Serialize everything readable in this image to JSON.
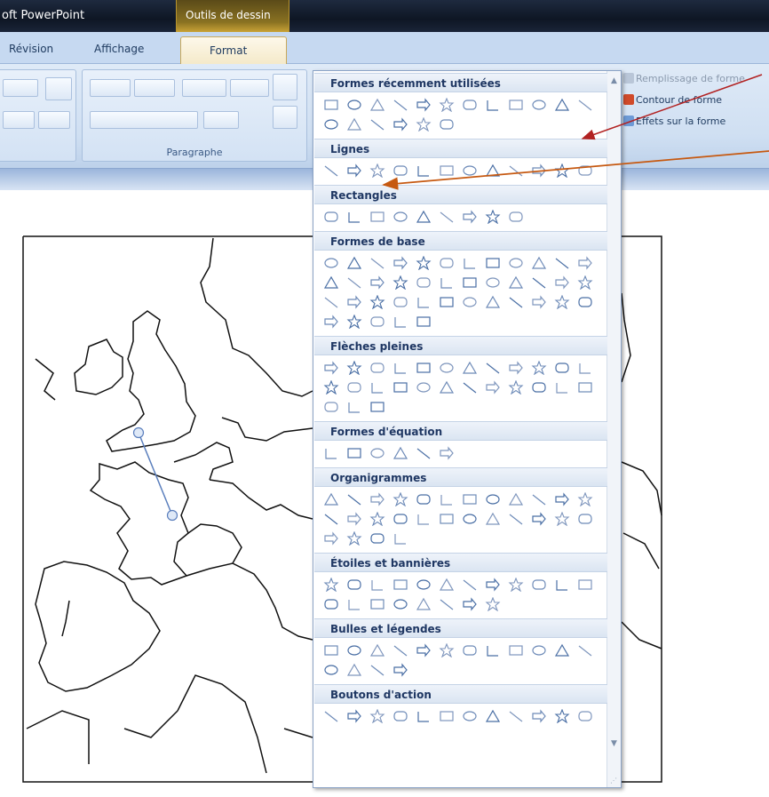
{
  "titlebar": {
    "app_title": "oft PowerPoint",
    "context_tab": "Outils de dessin"
  },
  "ribbon_tabs": {
    "revision": "Révision",
    "affichage": "Affichage",
    "format": "Format"
  },
  "ribbon": {
    "paragraph_group": "Paragraphe",
    "remplissage": "Remplissage de forme",
    "contour": "Contour de forme",
    "effets": "Effets sur la forme"
  },
  "gallery": {
    "sections": [
      {
        "title": "Formes récemment utilisées",
        "rows": [
          12,
          6
        ]
      },
      {
        "title": "Lignes",
        "rows": [
          12
        ]
      },
      {
        "title": "Rectangles",
        "rows": [
          9
        ]
      },
      {
        "title": "Formes de base",
        "rows": [
          12,
          12,
          12,
          5
        ]
      },
      {
        "title": "Flèches pleines",
        "rows": [
          12,
          12,
          3
        ]
      },
      {
        "title": "Formes d'équation",
        "rows": [
          6
        ]
      },
      {
        "title": "Organigrammes",
        "rows": [
          12,
          12,
          4
        ]
      },
      {
        "title": "Étoiles et bannières",
        "rows": [
          12,
          8
        ]
      },
      {
        "title": "Bulles et légendes",
        "rows": [
          12,
          4
        ]
      },
      {
        "title": "Boutons d'action",
        "rows": [
          12
        ]
      }
    ]
  },
  "colors": {
    "accent": "#c65911",
    "pointer": "#b22222",
    "connector": "#5b7fbd"
  },
  "icons": [
    "line-icon",
    "arrow-icon",
    "rectangle-icon",
    "oval-icon",
    "triangle-icon",
    "star-icon",
    "scroll-up-icon",
    "scroll-down-icon"
  ]
}
